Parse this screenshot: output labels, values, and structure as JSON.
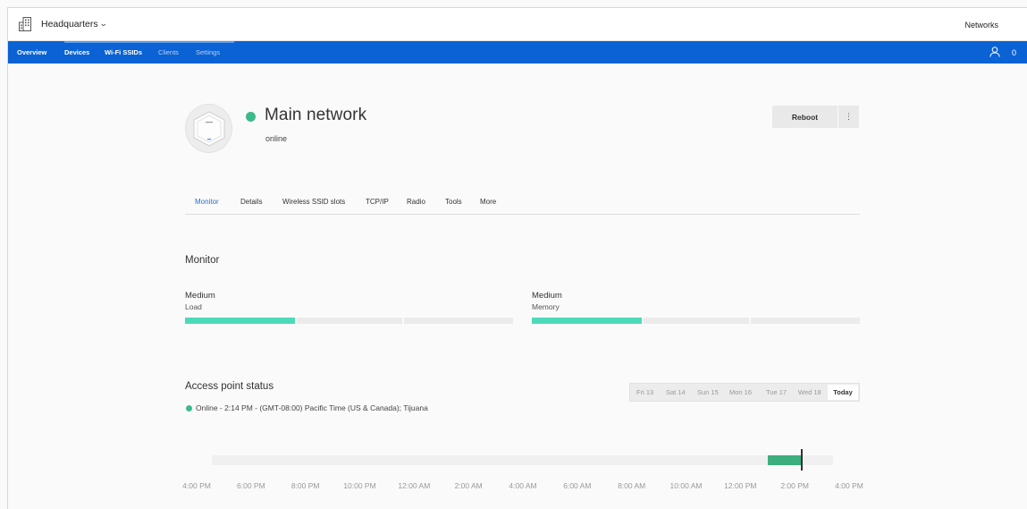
{
  "header": {
    "org_name": "Headquarters",
    "networks_link": "Networks",
    "user_count": "0"
  },
  "nav": {
    "items": [
      {
        "label": "Overview",
        "active": true
      },
      {
        "label": "Devices",
        "active": true
      },
      {
        "label": "Wi-Fi SSIDs",
        "active": true
      },
      {
        "label": "Clients",
        "active": false
      },
      {
        "label": "Settings",
        "active": false
      }
    ]
  },
  "device": {
    "name": "Main network",
    "status": "online",
    "status_color": "#3dba8a",
    "reboot_label": "Reboot",
    "more_label": "⋮"
  },
  "tabs": [
    {
      "label": "Monitor",
      "active": true
    },
    {
      "label": "Details"
    },
    {
      "label": "Wireless SSID slots"
    },
    {
      "label": "TCP/IP"
    },
    {
      "label": "Radio"
    },
    {
      "label": "Tools"
    },
    {
      "label": "More"
    }
  ],
  "monitor": {
    "title": "Monitor",
    "load": {
      "level": "Medium",
      "label": "Load",
      "filled_segments": 1,
      "total_segments": 3
    },
    "memory": {
      "level": "Medium",
      "label": "Memory",
      "filled_segments": 1,
      "total_segments": 3
    },
    "bar_color": "#4ddab9"
  },
  "access_point": {
    "title": "Access point status",
    "status_text": "Online - 2:14 PM - (GMT-08:00) Pacific Time (US & Canada); Tijuana",
    "days": [
      "Fri 13",
      "Sat 14",
      "Sun 15",
      "Mon 16",
      "Tue 17",
      "Wed 18"
    ],
    "today_label": "Today",
    "online_from_hour": 13.0,
    "now_hour": 14.23,
    "online_color": "#3dae7e",
    "time_ticks": [
      "4:00 PM",
      "6:00 PM",
      "8:00 PM",
      "10:00 PM",
      "12:00 AM",
      "2:00 AM",
      "4:00 AM",
      "6:00 AM",
      "8:00 AM",
      "10:00 AM",
      "12:00 PM",
      "2:00 PM",
      "4:00 PM"
    ]
  }
}
